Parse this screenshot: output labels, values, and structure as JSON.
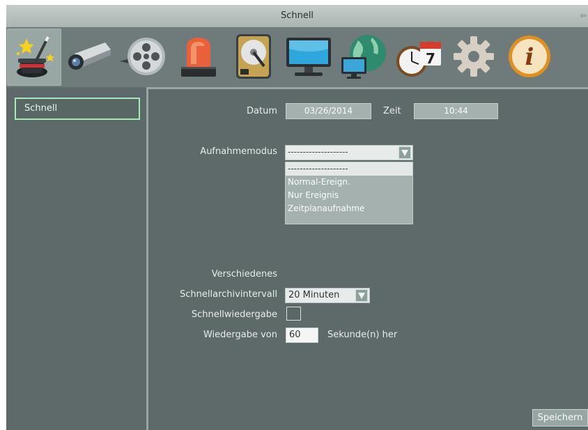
{
  "window": {
    "title": "Schnell",
    "back_icon": "back-arrow-icon"
  },
  "toolbar": {
    "tools": [
      {
        "name": "magic-wizard-icon",
        "selected": true
      },
      {
        "name": "camera-icon"
      },
      {
        "name": "film-reel-icon"
      },
      {
        "name": "alarm-siren-icon"
      },
      {
        "name": "hard-drive-icon"
      },
      {
        "name": "monitor-icon"
      },
      {
        "name": "network-globe-icon"
      },
      {
        "name": "clock-calendar-icon",
        "calendar_day": "7"
      },
      {
        "name": "settings-gear-icon"
      },
      {
        "name": "info-icon",
        "glyph": "i"
      }
    ]
  },
  "sidebar": {
    "items": [
      {
        "label": "Schnell",
        "selected": true
      }
    ]
  },
  "form": {
    "date_label": "Datum",
    "date_value": "03/26/2014",
    "time_label": "Zeit",
    "time_value": "10:44",
    "record_mode_label": "Aufnahmemodus",
    "record_mode_value": "--------------------",
    "record_mode_options": [
      "--------------------",
      "Normal-Ereign.",
      "Nur Ereignis",
      "Zeitplanaufnahme"
    ],
    "misc_heading": "Verschiedenes",
    "archive_interval_label": "Schnellarchivintervall",
    "archive_interval_value": "20 Minuten",
    "quick_playback_label": "Schnellwiedergabe",
    "quick_playback_checked": false,
    "playback_from_label": "Wiedergabe von",
    "playback_from_value": "60",
    "playback_unit": "Sekunde(n) her"
  },
  "actions": {
    "save_label": "Speichern"
  },
  "colors": {
    "panel": "#5e6a69",
    "selected_border": "#a7e9b7",
    "field": "#a5b1af"
  }
}
